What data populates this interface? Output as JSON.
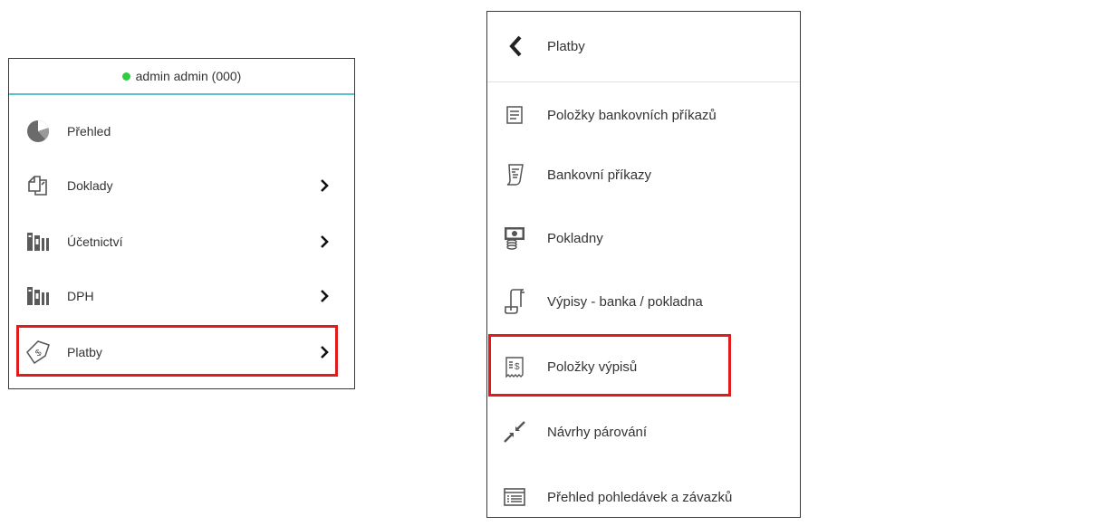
{
  "left_menu": {
    "user_status": "admin admin (000)",
    "status_color": "#2ecc40",
    "accent_color": "#5bc0cf",
    "items": [
      {
        "label": "Přehled",
        "icon": "pie-chart-icon",
        "has_submenu": false
      },
      {
        "label": "Doklady",
        "icon": "documents-icon",
        "has_submenu": true
      },
      {
        "label": "Účetnictví",
        "icon": "books-icon",
        "has_submenu": true
      },
      {
        "label": "DPH",
        "icon": "books-icon",
        "has_submenu": true
      },
      {
        "label": "Platby",
        "icon": "payment-tag-icon",
        "has_submenu": true,
        "highlighted": true
      }
    ]
  },
  "right_menu": {
    "title": "Platby",
    "items": [
      {
        "label": "Položky bankovních příkazů",
        "icon": "list-document-icon"
      },
      {
        "label": "Bankovní příkazy",
        "icon": "receipt-icon"
      },
      {
        "label": "Pokladny",
        "icon": "cash-register-icon"
      },
      {
        "label": "Výpisy - banka / pokladna",
        "icon": "scroll-icon"
      },
      {
        "label": "Položky výpisů",
        "icon": "statement-dollar-icon",
        "highlighted": true
      },
      {
        "label": "Návrhy párování",
        "icon": "collapse-arrows-icon"
      },
      {
        "label": "Přehled pohledávek a závazků",
        "icon": "overview-list-icon"
      }
    ]
  },
  "highlight_color": "#e01b1b"
}
